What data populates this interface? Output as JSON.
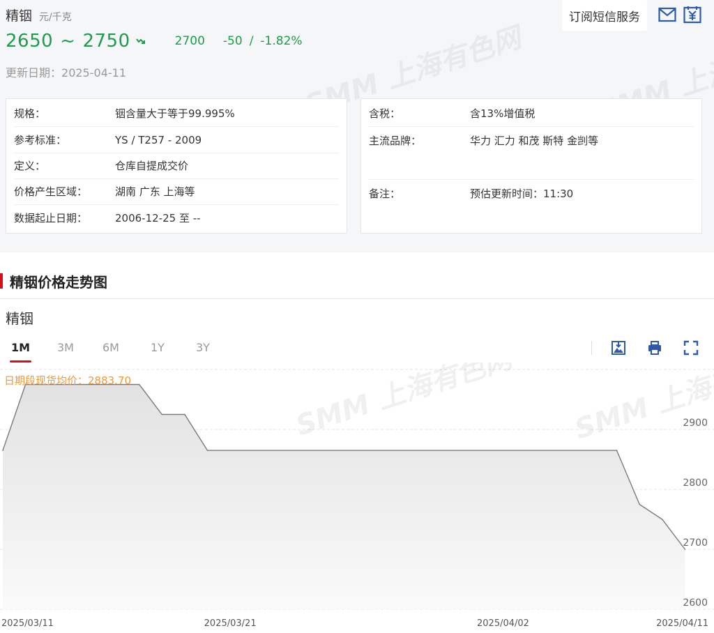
{
  "product": {
    "name": "精铟",
    "unit": "元/千克"
  },
  "price": {
    "range_low": "2650",
    "tilde": "~",
    "range_high": "2750",
    "avg": "2700",
    "change": "-50",
    "sep": "/",
    "change_pct": "-1.82%"
  },
  "update": {
    "label": "更新日期：",
    "date": "2025-04-11"
  },
  "subscribe": {
    "label": "订阅短信服务"
  },
  "icons": {
    "mail": "mail-icon",
    "price": "yuan-price-icon",
    "download": "download-image-icon",
    "print": "print-icon",
    "fullscreen": "fullscreen-icon",
    "trend": "down-trend-icon"
  },
  "colors": {
    "down_green": "#1f9b4c",
    "accent_red": "#d40f1a",
    "avg_orange": "#f0993b",
    "blue": "#2c5aa8"
  },
  "specs_left": [
    {
      "k": "规格：",
      "v": "铟含量大于等于99.995%"
    },
    {
      "k": "参考标准：",
      "v": "YS / T257 - 2009"
    },
    {
      "k": "定义：",
      "v": "仓库自提成交价"
    },
    {
      "k": "价格产生区域：",
      "v": "湖南 广东 上海等"
    },
    {
      "k": "数据起止日期：",
      "v": "2006-12-25 至 --"
    }
  ],
  "specs_right": [
    {
      "k": "含税：",
      "v": "含13%增值税"
    },
    {
      "k": "主流品牌：",
      "v": "华力 汇力 和茂 斯特 金剀等"
    },
    {
      "k": "备注：",
      "v": "预估更新时间：11:30"
    }
  ],
  "section": {
    "title": "精铟价格走势图"
  },
  "chart_title": "精铟",
  "tabs": [
    "1M",
    "3M",
    "6M",
    "1Y",
    "3Y"
  ],
  "active_tab": "1M",
  "avg_label": "日期段现货均价：2883.70",
  "watermark": "SMM 上海有色网",
  "chart_data": {
    "type": "area",
    "title": "精铟",
    "xlabel": "",
    "ylabel": "",
    "x_ticks": [
      "2025/03/11",
      "2025/03/21",
      "2025/04/02",
      "2025/04/11"
    ],
    "y_ticks": [
      2600,
      2700,
      2800,
      2900
    ],
    "ylim": [
      2600,
      3000
    ],
    "xlim": [
      "2025-03-11",
      "2025-04-11"
    ],
    "grid": "horizontal dashed",
    "points": [
      {
        "x": "2025-03-11",
        "y": 2865
      },
      {
        "x": "2025-03-12",
        "y": 2975
      },
      {
        "x": "2025-03-17",
        "y": 2975
      },
      {
        "x": "2025-03-18",
        "y": 2925
      },
      {
        "x": "2025-03-19",
        "y": 2925
      },
      {
        "x": "2025-03-20",
        "y": 2865
      },
      {
        "x": "2025-04-07",
        "y": 2865
      },
      {
        "x": "2025-04-08",
        "y": 2775
      },
      {
        "x": "2025-04-09",
        "y": 2750
      },
      {
        "x": "2025-04-10",
        "y": 2700
      }
    ]
  }
}
